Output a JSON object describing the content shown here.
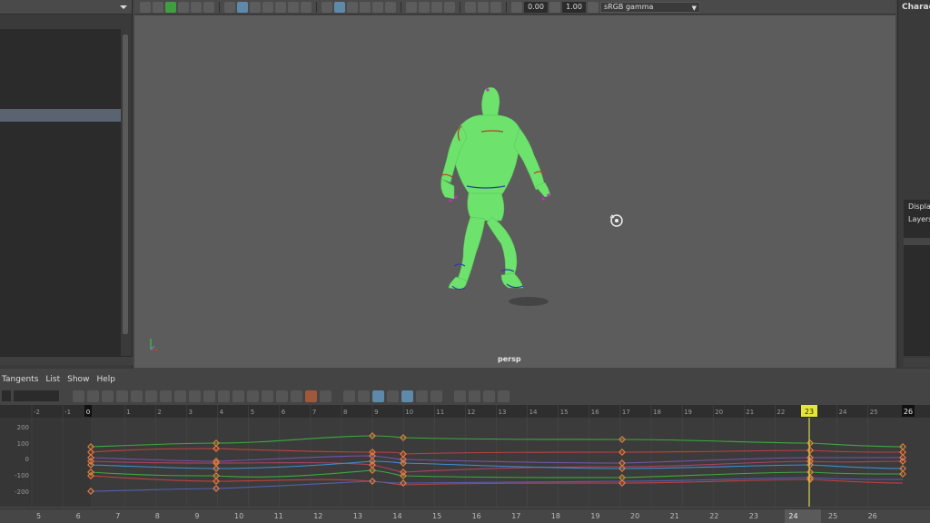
{
  "menus": {
    "graph_editor": [
      "Tangents",
      "List",
      "Show",
      "Help"
    ]
  },
  "toolbar": {
    "exposure_value": "0.00",
    "gamma_value": "1.00",
    "color_space": "sRGB gamma"
  },
  "viewport": {
    "camera_label": "persp"
  },
  "right_panel": {
    "title": "Characte",
    "display_tab": "Display",
    "layers_tab": "Layers"
  },
  "graph": {
    "y_ticks": [
      "200",
      "100",
      "0",
      "-100",
      "-200"
    ],
    "frame_ticks": [
      "-2",
      "-1",
      "0",
      "1",
      "2",
      "3",
      "4",
      "5",
      "6",
      "7",
      "8",
      "9",
      "10",
      "11",
      "12",
      "13",
      "14",
      "15",
      "16",
      "17",
      "18",
      "19",
      "20",
      "21",
      "22",
      "23",
      "24",
      "25",
      "26"
    ],
    "current_frame": "23",
    "end_frame": "26",
    "start_frame": "0"
  },
  "time_slider": {
    "ticks": [
      "5",
      "6",
      "7",
      "8",
      "9",
      "10",
      "11",
      "12",
      "13",
      "14",
      "15",
      "16",
      "17",
      "18",
      "19",
      "20",
      "21",
      "22",
      "23",
      "24",
      "25",
      "26"
    ],
    "current": "24"
  },
  "colors": {
    "character": "#6de26d",
    "key_orange": "#e07a3a",
    "current_frame_marker": "#e6e63a",
    "selection": "#5f89a8"
  }
}
